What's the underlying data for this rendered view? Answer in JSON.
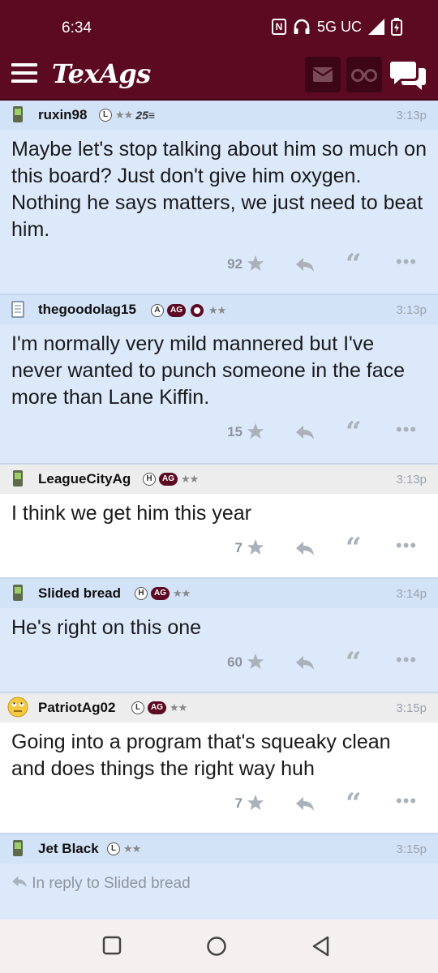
{
  "status": {
    "time": "6:34",
    "network": "5G UC"
  },
  "app": {
    "logo": "TexAgs"
  },
  "posts": [
    {
      "user": "ruxin98",
      "badges": [
        "L"
      ],
      "stars": "★★",
      "extra": "25≡",
      "time": "3:13p",
      "body": "Maybe let's stop talking about him so much on this board? Just don't give him oxygen. Nothing he says matters, we just need to beat him.",
      "count": "92"
    },
    {
      "user": "thegoodolag15",
      "badges": [
        "A"
      ],
      "ag": "AG",
      "stars": "★★",
      "time": "3:13p",
      "body": "I'm normally very mild mannered but I've never wanted to punch someone in the face more than Lane Kiffin.",
      "count": "15"
    },
    {
      "user": "LeagueCityAg",
      "badges": [
        "H"
      ],
      "ag": "AG",
      "stars": "★★",
      "time": "3:13p",
      "body": "I think we get him this year",
      "count": "7"
    },
    {
      "user": "Slided bread",
      "badges": [
        "H"
      ],
      "ag": "AG",
      "stars": "★★",
      "time": "3:14p",
      "body": "He's right on this one",
      "count": "60"
    },
    {
      "user": "PatriotAg02",
      "badges": [
        "L"
      ],
      "ag": "AG",
      "stars": "★★",
      "time": "3:15p",
      "body": "Going into a program that's squeaky clean and does things the right way huh",
      "count": "7"
    },
    {
      "user": "Jet Black",
      "badges": [
        "L"
      ],
      "stars": "★★",
      "time": "3:15p",
      "reply_to": "In reply to Slided bread"
    }
  ],
  "colors": {
    "maroon": "#5c0a22",
    "post_blue": "#dce9fb",
    "header_gray": "#ededed"
  }
}
